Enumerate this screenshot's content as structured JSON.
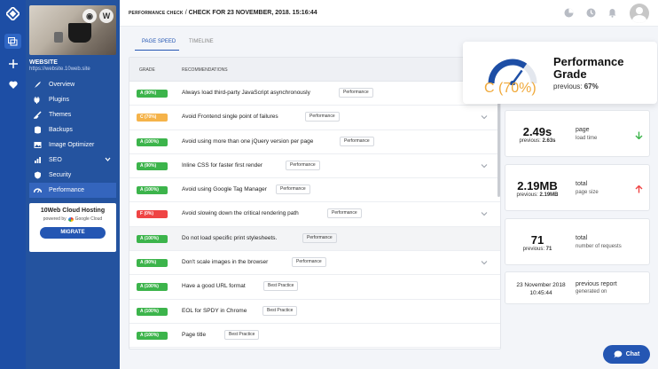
{
  "header": {
    "crumb_small": "PERFORMANCE CHECK",
    "crumb_sep": " / ",
    "crumb_big": "CHECK FOR 23 NOVEMBER, 2018. 15:16:44"
  },
  "site": {
    "name": "WEBSITE",
    "url": "https://website.10web.site"
  },
  "sidebar": {
    "items": [
      {
        "label": "Overview",
        "icon": "rocket-icon"
      },
      {
        "label": "Plugins",
        "icon": "plug-icon"
      },
      {
        "label": "Themes",
        "icon": "brush-icon"
      },
      {
        "label": "Backups",
        "icon": "database-icon"
      },
      {
        "label": "Image Optimizer",
        "icon": "image-icon"
      },
      {
        "label": "SEO",
        "icon": "chart-icon"
      },
      {
        "label": "Security",
        "icon": "shield-icon"
      },
      {
        "label": "Performance",
        "icon": "speedometer-icon"
      }
    ],
    "active": "Performance"
  },
  "promo": {
    "title": "10Web Cloud Hosting",
    "powered_by": "powered by",
    "brand": "Google Cloud",
    "button": "MIGRATE"
  },
  "tabs": [
    "PAGE SPEED",
    "TIMELINE"
  ],
  "table": {
    "headers": {
      "grade": "GRADE",
      "recommendations": "RECOMMENDATIONS"
    },
    "rows": [
      {
        "grade": "A (90%)",
        "color": "#3cb44b",
        "text": "Always load third-party JavaScript asynchronously",
        "tag": "Performance",
        "expandable": false
      },
      {
        "grade": "C (70%)",
        "color": "#f5b34a",
        "text": "Avoid Frontend single point of failures",
        "tag": "Performance",
        "expandable": true
      },
      {
        "grade": "A (100%)",
        "color": "#3cb44b",
        "text": "Avoid using more than one jQuery version per page",
        "tag": "Performance",
        "expandable": false
      },
      {
        "grade": "A (90%)",
        "color": "#3cb44b",
        "text": "Inline CSS for faster first render",
        "tag": "Performance",
        "expandable": true
      },
      {
        "grade": "A (100%)",
        "color": "#3cb44b",
        "text": "Avoid using Google Tag Manager",
        "tag": "Performance",
        "expandable": false
      },
      {
        "grade": "F (0%)",
        "color": "#ef4444",
        "text": "Avoid slowing down the critical rendering path",
        "tag": "Performance",
        "expandable": true
      },
      {
        "grade": "A (100%)",
        "color": "#3cb44b",
        "text": "Do not load specific print stylesheets.",
        "tag": "Performance",
        "expandable": false
      },
      {
        "grade": "A (90%)",
        "color": "#3cb44b",
        "text": "Don't scale images in the browser",
        "tag": "Performance",
        "expandable": true
      },
      {
        "grade": "A (100%)",
        "color": "#3cb44b",
        "text": "Have a good URL format",
        "tag": "Best Practice",
        "expandable": false
      },
      {
        "grade": "A (100%)",
        "color": "#3cb44b",
        "text": "EOL for SPDY in Chrome",
        "tag": "Best Practice",
        "expandable": false
      },
      {
        "grade": "A (100%)",
        "color": "#3cb44b",
        "text": "Page title",
        "tag": "Best Practice",
        "expandable": false
      }
    ]
  },
  "grade_card": {
    "value": "C (70%)",
    "title": "Performance Grade",
    "previous_label": "previous:",
    "previous_value": "67%",
    "score": 0.7,
    "color": "#f0a93a",
    "gauge_color": "#1d4ea5"
  },
  "metrics": [
    {
      "value": "2.49s",
      "prev_label": "previous:",
      "prev_value": "2.63s",
      "label": "page",
      "sublabel": "load time",
      "trend": "down",
      "trend_color": "#3cb44b"
    },
    {
      "value": "2.19MB",
      "prev_label": "previous:",
      "prev_value": "2.19MB",
      "label": "total",
      "sublabel": "page size",
      "trend": "up",
      "trend_color": "#ef4444"
    },
    {
      "value": "71",
      "prev_label": "previous:",
      "prev_value": "71",
      "label": "total",
      "sublabel": "number of requests",
      "trend": "",
      "trend_color": ""
    }
  ],
  "report": {
    "date": "23 November 2018",
    "time": "10:45:44",
    "label": "previous report",
    "sublabel": "generated on"
  },
  "chat": {
    "label": "Chat"
  }
}
